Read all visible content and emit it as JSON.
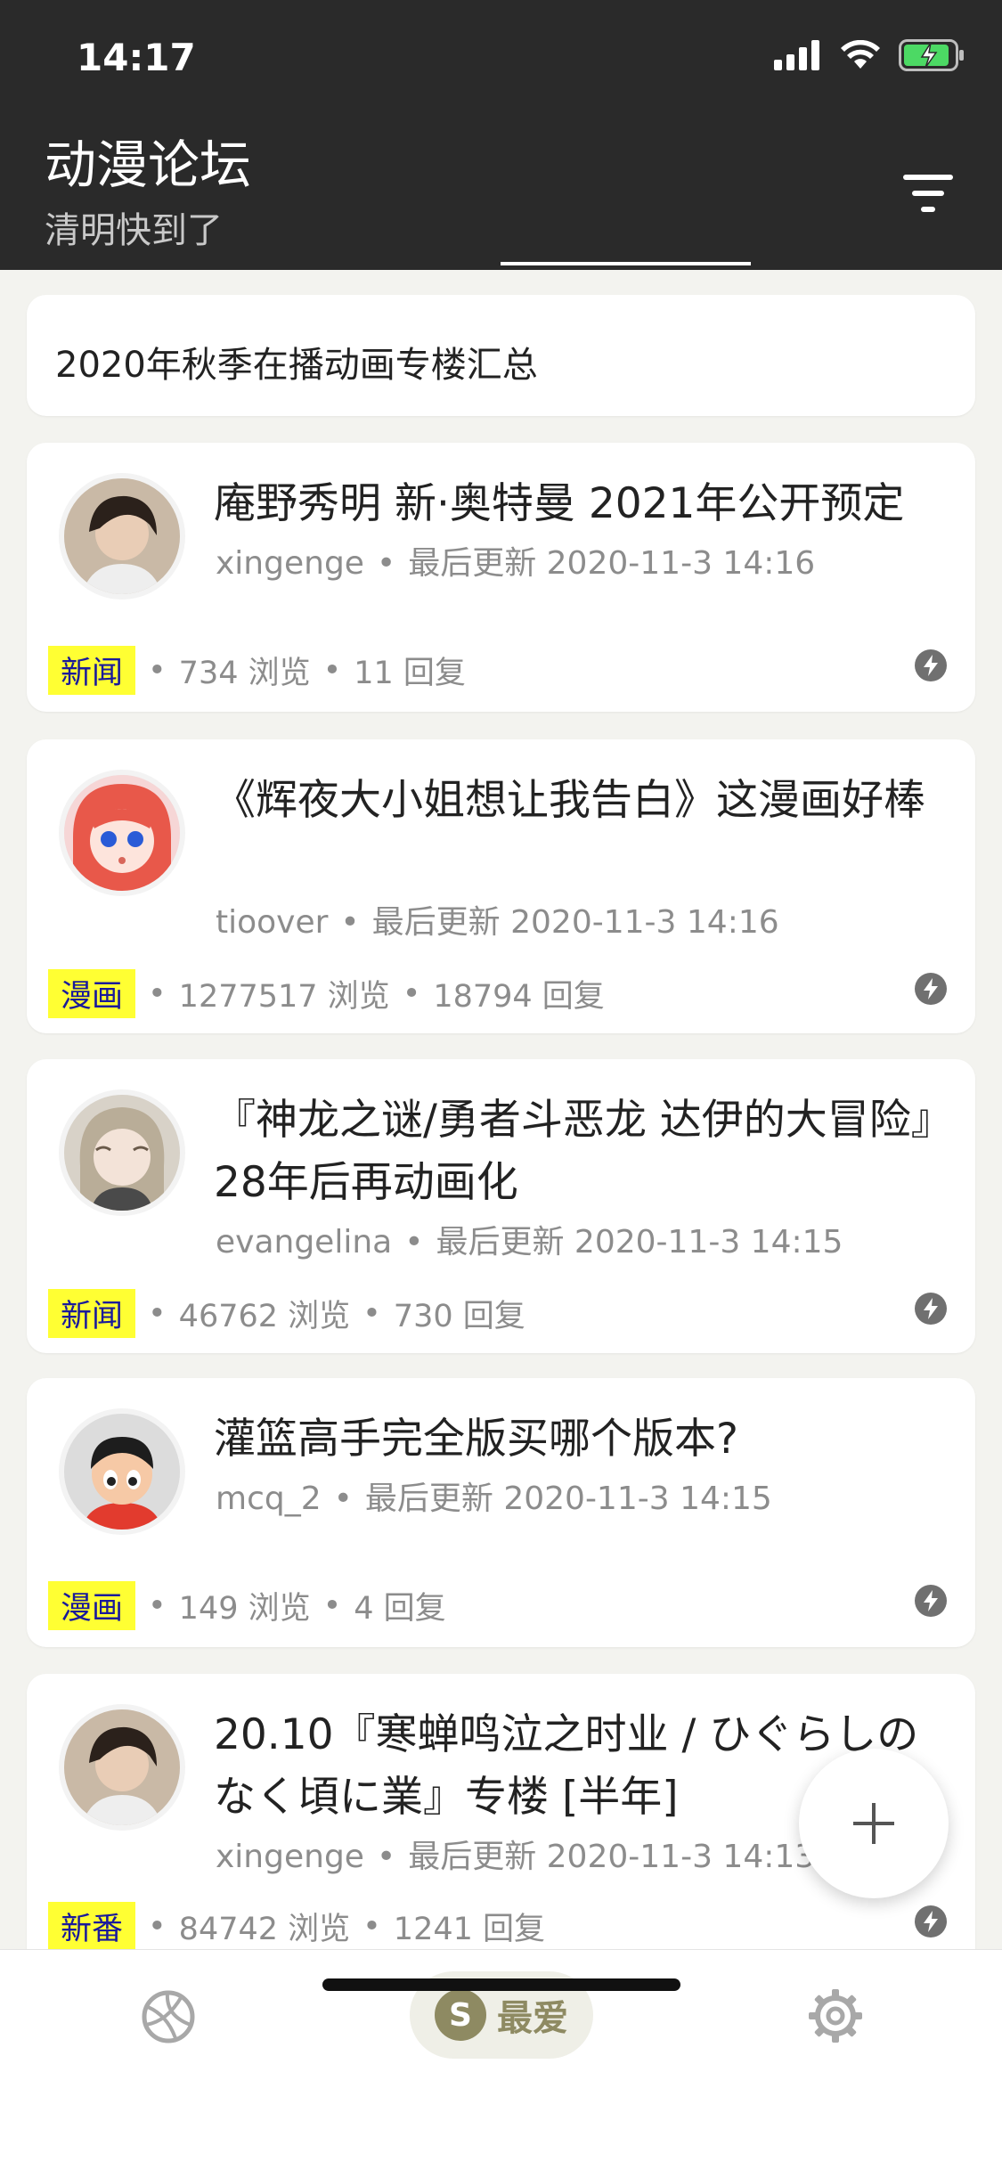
{
  "status_bar": {
    "time": "14:17"
  },
  "header": {
    "title": "动漫论坛",
    "subtitle": "清明快到了"
  },
  "pinned": {
    "text": "2020年秋季在播动画专楼汇总"
  },
  "posts": [
    {
      "title": "庵野秀明 新·奥特曼 2021年公开预定",
      "author": "xingenge",
      "updated_label": "最后更新",
      "updated": "2020-11-3 14:16",
      "tag": "新闻",
      "views": "734 浏览",
      "replies": "11 回复"
    },
    {
      "title": "《辉夜大小姐想让我告白》这漫画好棒",
      "author": "tioover",
      "updated_label": "最后更新",
      "updated": "2020-11-3 14:16",
      "tag": "漫画",
      "views": "1277517 浏览",
      "replies": "18794 回复"
    },
    {
      "title": "『神龙之谜/勇者斗恶龙 达伊的大冒险』28年后再动画化",
      "author": "evangelina",
      "updated_label": "最后更新",
      "updated": "2020-11-3 14:15",
      "tag": "新闻",
      "views": "46762 浏览",
      "replies": "730 回复"
    },
    {
      "title": "灌篮高手完全版买哪个版本?",
      "author": "mcq_2",
      "updated_label": "最后更新",
      "updated": "2020-11-3 14:15",
      "tag": "漫画",
      "views": "149 浏览",
      "replies": "4 回复"
    },
    {
      "title": "20.10『寒蝉鸣泣之时业 / ひぐらしのなく頃に業』专楼 [半年]",
      "author": "xingenge",
      "updated_label": "最后更新",
      "updated": "2020-11-3 14:13",
      "tag": "新番",
      "views": "84742 浏览",
      "replies": "1241 回复"
    }
  ],
  "bottom_nav": {
    "fav_badge": "S",
    "fav_label": "最爱"
  },
  "colors": {
    "header_bg": "#2a2a2a",
    "tag_bg": "#ffff33",
    "tag_text": "#1a1a9a",
    "accent": "#8e8a62"
  },
  "icons": [
    "signal-icon",
    "wifi-icon",
    "battery-charging-icon",
    "filter-icon",
    "bolt-icon",
    "plus-icon",
    "ball-icon",
    "gear-icon"
  ]
}
